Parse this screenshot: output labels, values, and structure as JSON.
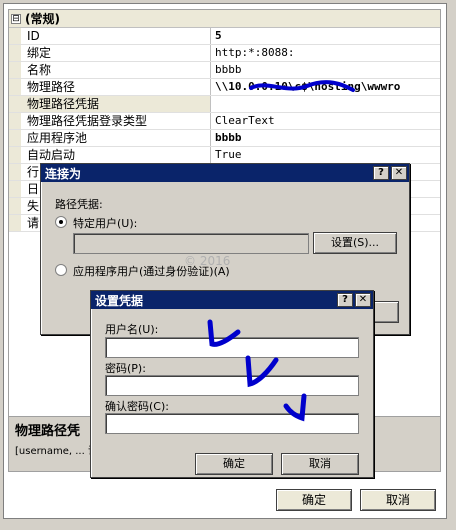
{
  "grid": {
    "category": "(常规)",
    "category_expander": "⊟",
    "rows": [
      {
        "name": "ID",
        "value": "5"
      },
      {
        "name": "绑定",
        "value": "http:*:8088:"
      },
      {
        "name": "名称",
        "value": "bbbb"
      },
      {
        "name": "物理路径",
        "value": "\\\\10.0.0.10\\c$\\hosting\\wwwro"
      },
      {
        "name": "物理路径凭据",
        "value": ""
      },
      {
        "name": "物理路径凭据登录类型",
        "value": "ClearText"
      },
      {
        "name": "应用程序池",
        "value": "bbbb"
      },
      {
        "name": "自动启动",
        "value": "True"
      }
    ],
    "partial_rows": [
      "行",
      "日",
      "失",
      "请"
    ]
  },
  "description": {
    "title": "物理路径凭",
    "body": "[username, ...                                          识的凭据。"
  },
  "footer": {
    "ok": "确定",
    "cancel": "取消"
  },
  "connect_as": {
    "title": "连接为",
    "help": "?",
    "close": "✕",
    "group_label": "路径凭据:",
    "specific_user": "特定用户(U):",
    "set_button": "设置(S)...",
    "app_user": "应用程序用户(通过身份验证)(A)"
  },
  "watermark": "© 2016",
  "set_credentials": {
    "title": "设置凭据",
    "help": "?",
    "close": "✕",
    "username_label": "用户名(U):",
    "username_value": "",
    "password_label": "密码(P):",
    "password_value": "",
    "confirm_label": "确认密码(C):",
    "confirm_value": "",
    "ok": "确定",
    "cancel": "取消"
  }
}
